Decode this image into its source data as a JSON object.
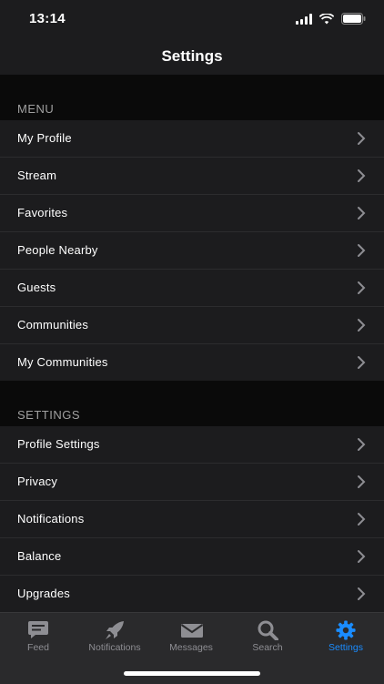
{
  "status": {
    "time": "13:14"
  },
  "nav": {
    "title": "Settings"
  },
  "sections": {
    "menu": {
      "header": "MENU",
      "items": [
        "My Profile",
        "Stream",
        "Favorites",
        "People Nearby",
        "Guests",
        "Communities",
        "My Communities"
      ]
    },
    "settings": {
      "header": "SETTINGS",
      "items": [
        "Profile Settings",
        "Privacy",
        "Notifications",
        "Balance",
        "Upgrades"
      ]
    }
  },
  "tabs": [
    {
      "label": "Feed",
      "icon": "chat-bubble-icon"
    },
    {
      "label": "Notifications",
      "icon": "rocket-icon"
    },
    {
      "label": "Messages",
      "icon": "envelope-icon"
    },
    {
      "label": "Search",
      "icon": "magnifier-icon"
    },
    {
      "label": "Settings",
      "icon": "gear-icon",
      "active": true
    }
  ],
  "colors": {
    "accent": "#1a8cff",
    "background": "#000000",
    "row": "#1c1c1e",
    "inactive": "#8e8e93"
  }
}
